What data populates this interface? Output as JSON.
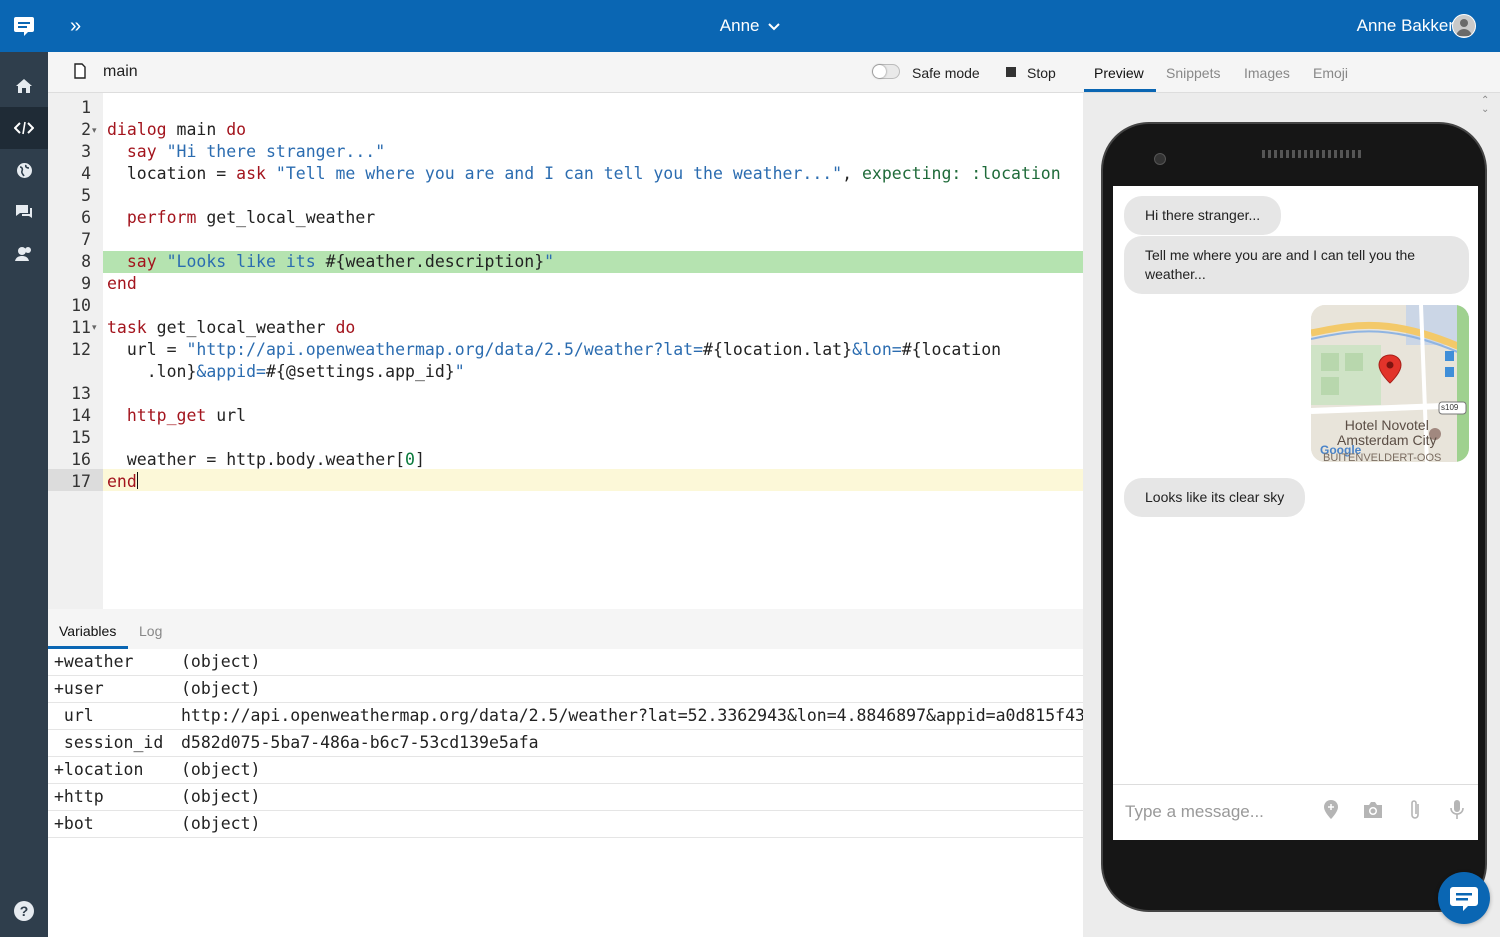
{
  "header": {
    "bot_name": "Anne",
    "user_name": "Anne Bakker",
    "expand_icon": "double-chevron-right-icon",
    "logo_icon": "chat-bubble-logo-icon"
  },
  "sidebar": {
    "items": [
      {
        "icon": "home-icon"
      },
      {
        "icon": "code-icon"
      },
      {
        "icon": "globe-icon"
      },
      {
        "icon": "conversations-icon"
      },
      {
        "icon": "users-icon"
      }
    ],
    "help_icon": "help-icon"
  },
  "toolbar": {
    "file_name": "main",
    "safe_mode_label": "Safe mode",
    "safe_mode_on": false,
    "stop_label": "Stop"
  },
  "right_tabs": [
    "Preview",
    "Snippets",
    "Images",
    "Emoji"
  ],
  "editor": {
    "line_numbers": [
      "1",
      "2",
      "3",
      "4",
      "5",
      "6",
      "7",
      "8",
      "9",
      "10",
      "11",
      "12",
      "",
      "13",
      "14",
      "15",
      "16",
      "17"
    ],
    "highlighted_line": 8,
    "current_line": 17
  },
  "bottom_tabs": [
    "Variables",
    "Log"
  ],
  "variables": [
    {
      "name": "+weather",
      "value": "(object)"
    },
    {
      "name": "+user",
      "value": "(object)"
    },
    {
      "name": " url",
      "value": "http://api.openweathermap.org/data/2.5/weather?lat=52.3362943&lon=4.8846897&appid=a0d815f43"
    },
    {
      "name": " session_id",
      "value": "d582d075-5ba7-486a-b6c7-53cd139e5afa"
    },
    {
      "name": "+location",
      "value": "(object)"
    },
    {
      "name": "+http",
      "value": "(object)"
    },
    {
      "name": "+bot",
      "value": "(object)"
    }
  ],
  "chat": {
    "messages": [
      "Hi there stranger...",
      "Tell me where you are and I can tell you the weather...",
      "Looks like its clear sky"
    ],
    "map": {
      "hotel_line1": "Hotel Novotel",
      "hotel_line2": "Amsterdam City",
      "road_badge": "s109",
      "google_label": "Google",
      "street_label": "BUITENVELDERT-OOS"
    },
    "input_placeholder": "Type a message...",
    "input_icons": [
      "location-pin-icon",
      "camera-icon",
      "paperclip-icon",
      "microphone-icon"
    ]
  },
  "colors": {
    "brand": "#0a66b3",
    "sidebar": "#2f3e4c",
    "highlight_line": "#b5e3b0",
    "current_line": "#fcf8d8"
  }
}
